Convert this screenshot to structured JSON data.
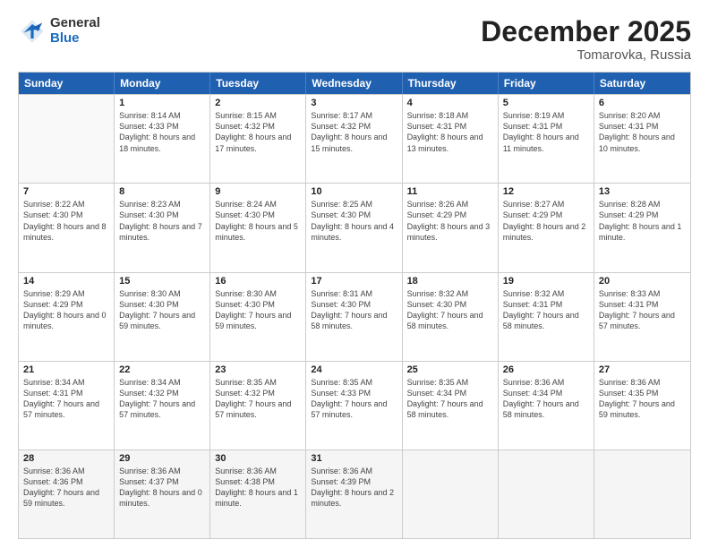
{
  "logo": {
    "general": "General",
    "blue": "Blue"
  },
  "header": {
    "month": "December 2025",
    "location": "Tomarovka, Russia"
  },
  "days_of_week": [
    "Sunday",
    "Monday",
    "Tuesday",
    "Wednesday",
    "Thursday",
    "Friday",
    "Saturday"
  ],
  "weeks": [
    [
      {
        "day": "",
        "sunrise": "",
        "sunset": "",
        "daylight": "",
        "empty": true
      },
      {
        "day": "1",
        "sunrise": "Sunrise: 8:14 AM",
        "sunset": "Sunset: 4:33 PM",
        "daylight": "Daylight: 8 hours and 18 minutes."
      },
      {
        "day": "2",
        "sunrise": "Sunrise: 8:15 AM",
        "sunset": "Sunset: 4:32 PM",
        "daylight": "Daylight: 8 hours and 17 minutes."
      },
      {
        "day": "3",
        "sunrise": "Sunrise: 8:17 AM",
        "sunset": "Sunset: 4:32 PM",
        "daylight": "Daylight: 8 hours and 15 minutes."
      },
      {
        "day": "4",
        "sunrise": "Sunrise: 8:18 AM",
        "sunset": "Sunset: 4:31 PM",
        "daylight": "Daylight: 8 hours and 13 minutes."
      },
      {
        "day": "5",
        "sunrise": "Sunrise: 8:19 AM",
        "sunset": "Sunset: 4:31 PM",
        "daylight": "Daylight: 8 hours and 11 minutes."
      },
      {
        "day": "6",
        "sunrise": "Sunrise: 8:20 AM",
        "sunset": "Sunset: 4:31 PM",
        "daylight": "Daylight: 8 hours and 10 minutes."
      }
    ],
    [
      {
        "day": "7",
        "sunrise": "Sunrise: 8:22 AM",
        "sunset": "Sunset: 4:30 PM",
        "daylight": "Daylight: 8 hours and 8 minutes."
      },
      {
        "day": "8",
        "sunrise": "Sunrise: 8:23 AM",
        "sunset": "Sunset: 4:30 PM",
        "daylight": "Daylight: 8 hours and 7 minutes."
      },
      {
        "day": "9",
        "sunrise": "Sunrise: 8:24 AM",
        "sunset": "Sunset: 4:30 PM",
        "daylight": "Daylight: 8 hours and 5 minutes."
      },
      {
        "day": "10",
        "sunrise": "Sunrise: 8:25 AM",
        "sunset": "Sunset: 4:30 PM",
        "daylight": "Daylight: 8 hours and 4 minutes."
      },
      {
        "day": "11",
        "sunrise": "Sunrise: 8:26 AM",
        "sunset": "Sunset: 4:29 PM",
        "daylight": "Daylight: 8 hours and 3 minutes."
      },
      {
        "day": "12",
        "sunrise": "Sunrise: 8:27 AM",
        "sunset": "Sunset: 4:29 PM",
        "daylight": "Daylight: 8 hours and 2 minutes."
      },
      {
        "day": "13",
        "sunrise": "Sunrise: 8:28 AM",
        "sunset": "Sunset: 4:29 PM",
        "daylight": "Daylight: 8 hours and 1 minute."
      }
    ],
    [
      {
        "day": "14",
        "sunrise": "Sunrise: 8:29 AM",
        "sunset": "Sunset: 4:29 PM",
        "daylight": "Daylight: 8 hours and 0 minutes."
      },
      {
        "day": "15",
        "sunrise": "Sunrise: 8:30 AM",
        "sunset": "Sunset: 4:30 PM",
        "daylight": "Daylight: 7 hours and 59 minutes."
      },
      {
        "day": "16",
        "sunrise": "Sunrise: 8:30 AM",
        "sunset": "Sunset: 4:30 PM",
        "daylight": "Daylight: 7 hours and 59 minutes."
      },
      {
        "day": "17",
        "sunrise": "Sunrise: 8:31 AM",
        "sunset": "Sunset: 4:30 PM",
        "daylight": "Daylight: 7 hours and 58 minutes."
      },
      {
        "day": "18",
        "sunrise": "Sunrise: 8:32 AM",
        "sunset": "Sunset: 4:30 PM",
        "daylight": "Daylight: 7 hours and 58 minutes."
      },
      {
        "day": "19",
        "sunrise": "Sunrise: 8:32 AM",
        "sunset": "Sunset: 4:31 PM",
        "daylight": "Daylight: 7 hours and 58 minutes."
      },
      {
        "day": "20",
        "sunrise": "Sunrise: 8:33 AM",
        "sunset": "Sunset: 4:31 PM",
        "daylight": "Daylight: 7 hours and 57 minutes."
      }
    ],
    [
      {
        "day": "21",
        "sunrise": "Sunrise: 8:34 AM",
        "sunset": "Sunset: 4:31 PM",
        "daylight": "Daylight: 7 hours and 57 minutes."
      },
      {
        "day": "22",
        "sunrise": "Sunrise: 8:34 AM",
        "sunset": "Sunset: 4:32 PM",
        "daylight": "Daylight: 7 hours and 57 minutes."
      },
      {
        "day": "23",
        "sunrise": "Sunrise: 8:35 AM",
        "sunset": "Sunset: 4:32 PM",
        "daylight": "Daylight: 7 hours and 57 minutes."
      },
      {
        "day": "24",
        "sunrise": "Sunrise: 8:35 AM",
        "sunset": "Sunset: 4:33 PM",
        "daylight": "Daylight: 7 hours and 57 minutes."
      },
      {
        "day": "25",
        "sunrise": "Sunrise: 8:35 AM",
        "sunset": "Sunset: 4:34 PM",
        "daylight": "Daylight: 7 hours and 58 minutes."
      },
      {
        "day": "26",
        "sunrise": "Sunrise: 8:36 AM",
        "sunset": "Sunset: 4:34 PM",
        "daylight": "Daylight: 7 hours and 58 minutes."
      },
      {
        "day": "27",
        "sunrise": "Sunrise: 8:36 AM",
        "sunset": "Sunset: 4:35 PM",
        "daylight": "Daylight: 7 hours and 59 minutes."
      }
    ],
    [
      {
        "day": "28",
        "sunrise": "Sunrise: 8:36 AM",
        "sunset": "Sunset: 4:36 PM",
        "daylight": "Daylight: 7 hours and 59 minutes."
      },
      {
        "day": "29",
        "sunrise": "Sunrise: 8:36 AM",
        "sunset": "Sunset: 4:37 PM",
        "daylight": "Daylight: 8 hours and 0 minutes."
      },
      {
        "day": "30",
        "sunrise": "Sunrise: 8:36 AM",
        "sunset": "Sunset: 4:38 PM",
        "daylight": "Daylight: 8 hours and 1 minute."
      },
      {
        "day": "31",
        "sunrise": "Sunrise: 8:36 AM",
        "sunset": "Sunset: 4:39 PM",
        "daylight": "Daylight: 8 hours and 2 minutes."
      },
      {
        "day": "",
        "sunrise": "",
        "sunset": "",
        "daylight": "",
        "empty": true
      },
      {
        "day": "",
        "sunrise": "",
        "sunset": "",
        "daylight": "",
        "empty": true
      },
      {
        "day": "",
        "sunrise": "",
        "sunset": "",
        "daylight": "",
        "empty": true
      }
    ]
  ]
}
